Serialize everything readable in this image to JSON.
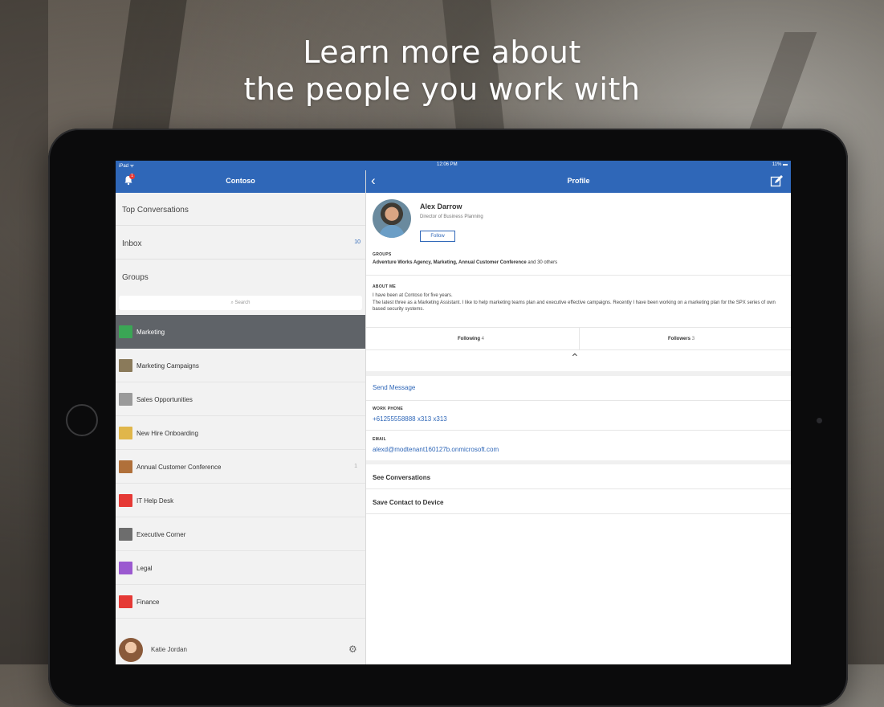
{
  "headline": {
    "line1": "Learn more about",
    "line2": "the people you work with"
  },
  "status_bar": {
    "carrier": "iPad ᯤ",
    "time": "12:06 PM",
    "battery": "11% ▬"
  },
  "sidebar": {
    "title": "Contoso",
    "notification_count": "1",
    "top_items": [
      {
        "label": "Top Conversations",
        "count": ""
      },
      {
        "label": "Inbox",
        "count": "10"
      },
      {
        "label": "Groups",
        "count": ""
      }
    ],
    "search_placeholder": "⌕ Search",
    "groups": [
      {
        "name": "Marketing",
        "count": "",
        "color": "#3aa655",
        "selected": true
      },
      {
        "name": "Marketing Campaigns",
        "count": "",
        "color": "#8a7a5a"
      },
      {
        "name": "Sales Opportunities",
        "count": "",
        "color": "#9a9a9a"
      },
      {
        "name": "New Hire Onboarding",
        "count": "",
        "color": "#e0b64a"
      },
      {
        "name": "Annual Customer Conference",
        "count": "1",
        "color": "#b0703a"
      },
      {
        "name": "IT Help Desk",
        "count": "",
        "color": "#e53935"
      },
      {
        "name": "Executive Corner",
        "count": "",
        "color": "#6d6d6d"
      },
      {
        "name": "Legal",
        "count": "",
        "color": "#9b59d0"
      },
      {
        "name": "Finance",
        "count": "",
        "color": "#e53935"
      }
    ],
    "user": {
      "name": "Katie Jordan",
      "settings_icon": "gear-icon"
    }
  },
  "profile": {
    "nav_title": "Profile",
    "name": "Alex Darrow",
    "job_title": "Director of Business Planning",
    "follow_label": "Follow",
    "groups_label": "GROUPS",
    "groups_value": "Adventure Works Agency, Marketing, Annual Customer Conference",
    "groups_more": " and 30 others",
    "about_label": "ABOUT ME",
    "about_line1": "I have been at Contoso for five years.",
    "about_line2": "The latest three as a Marketing Assistant. I like to help marketing teams plan and executive effective campaigns. Recently I have been working on a marketing plan for the SPX series of own based security systems.",
    "following_label": "Following",
    "following_count": "4",
    "followers_label": "Followers",
    "followers_count": "3",
    "send_message": "Send Message",
    "work_phone_label": "WORK PHONE",
    "work_phone": "+61255558888 x313 x313",
    "email_label": "EMAIL",
    "email": "alexd@modtenant160127b.onmicrosoft.com",
    "see_conversations": "See Conversations",
    "save_contact": "Save Contact to Device"
  },
  "colors": {
    "brand_blue": "#2f67b8",
    "selected_row": "#5f6368"
  }
}
